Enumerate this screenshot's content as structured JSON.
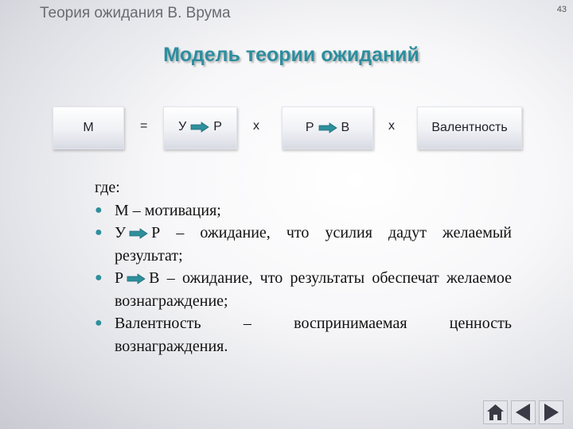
{
  "header": {
    "title": "Теория ожидания В. Врума",
    "page_number": "43"
  },
  "slide": {
    "title": "Модель теории ожиданий"
  },
  "formula": {
    "box_m": "М",
    "equals": "=",
    "box_ur": {
      "left": "У",
      "right": "Р"
    },
    "times_1": "х",
    "box_rv": {
      "left": "Р",
      "right": "В"
    },
    "times_2": "х",
    "box_valence": "Валентность"
  },
  "definitions": {
    "intro": "где:",
    "items": [
      {
        "text": "М – мотивация;"
      },
      {
        "lead": "У",
        "rest": "Р – ожидание, что усилия дадут желаемый результат;"
      },
      {
        "lead": "Р",
        "rest": "В – ожидание, что результаты обеспечат желаемое вознаграждение;"
      },
      {
        "text": "Валентность – воспринимаемая ценность вознаграждения."
      }
    ]
  },
  "colors": {
    "title": "#2c8e9e",
    "bullet": "#2f8f9c",
    "arrow": "#2f8f9c"
  },
  "navigation": {
    "icons": [
      "home-icon",
      "previous-icon",
      "next-icon"
    ]
  }
}
